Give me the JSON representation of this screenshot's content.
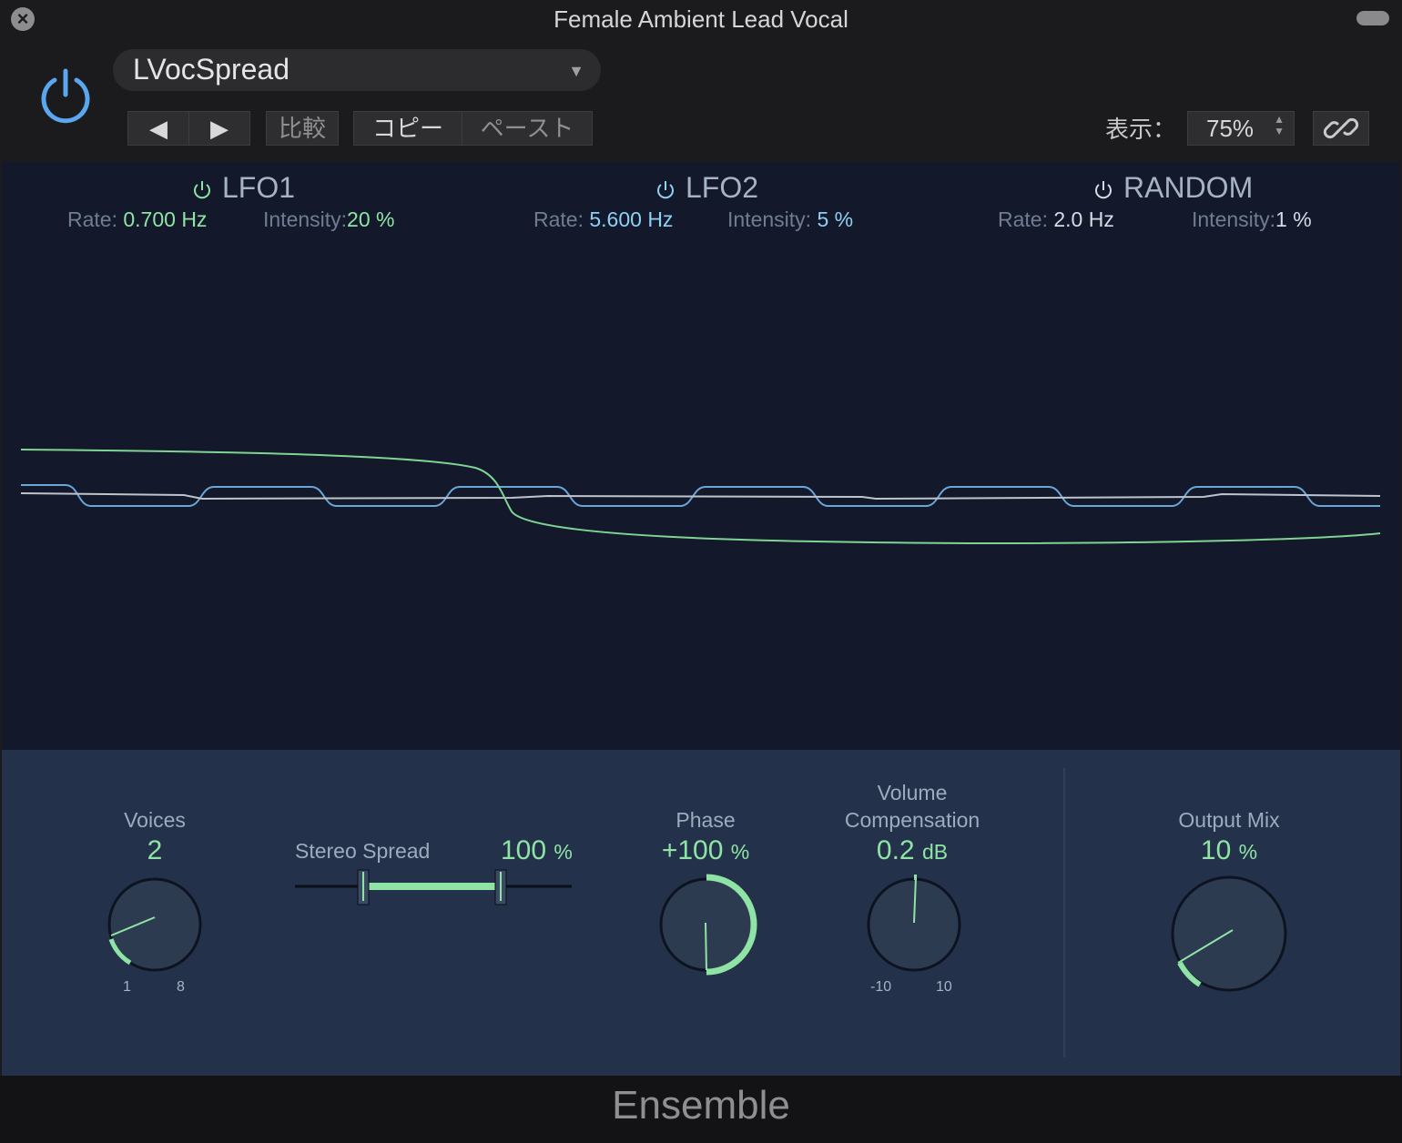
{
  "window": {
    "title": "Female Ambient Lead Vocal"
  },
  "header": {
    "preset_name": "LVocSpread",
    "compare_label": "比較",
    "copy_label": "コピー",
    "paste_label": "ペースト",
    "view_label": "表示：",
    "zoom_value": "75%"
  },
  "lfo1": {
    "name": "LFO1",
    "rate_label": "Rate:",
    "rate_value": "0.700 Hz",
    "intensity_label": "Intensity:",
    "intensity_value": "20 %"
  },
  "lfo2": {
    "name": "LFO2",
    "rate_label": "Rate:",
    "rate_value": "5.600 Hz",
    "intensity_label": "Intensity:",
    "intensity_value": "5 %"
  },
  "random": {
    "name": "RANDOM",
    "rate_label": "Rate:",
    "rate_value": "2.0 Hz",
    "intensity_label": "Intensity:",
    "intensity_value": "1 %"
  },
  "controls": {
    "voices": {
      "label": "Voices",
      "value": "2",
      "min": "1",
      "max": "8",
      "level": 0.14
    },
    "stereo_spread": {
      "label": "Stereo Spread",
      "value": "100",
      "unit": "%"
    },
    "phase": {
      "label": "Phase",
      "value": "+100",
      "unit": "%",
      "level": 1.0
    },
    "volume_compensation": {
      "label_line1": "Volume",
      "label_line2": "Compensation",
      "value": "0.2",
      "unit": "dB",
      "min": "-10",
      "max": "10"
    },
    "output_mix": {
      "label": "Output Mix",
      "value": "10",
      "unit": "%",
      "level": 0.1
    }
  },
  "footer": {
    "plugin_name": "Ensemble"
  },
  "colors": {
    "accent_green": "#8fe3a5",
    "accent_blue": "#8fd0f5",
    "power_blue": "#5aa7f0"
  },
  "icons": [
    "close-icon",
    "power-icon",
    "chevron-down-icon",
    "prev-icon",
    "next-icon",
    "link-icon"
  ]
}
